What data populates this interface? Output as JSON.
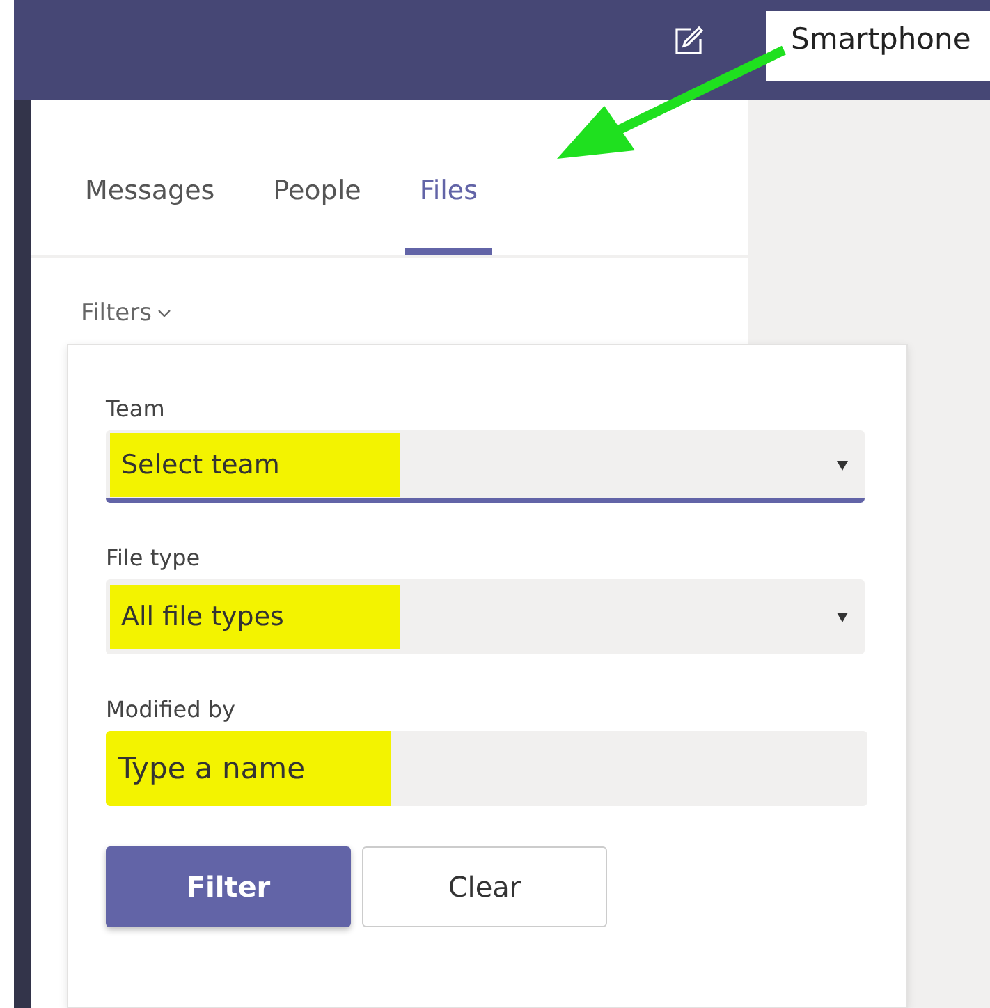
{
  "header": {
    "label": "Smartphone"
  },
  "tabs": [
    {
      "label": "Messages",
      "selected": false
    },
    {
      "label": "People",
      "selected": false
    },
    {
      "label": "Files",
      "selected": true
    }
  ],
  "filters_toggle": {
    "label": "Filters",
    "expanded": true
  },
  "filter_form": {
    "fields": [
      {
        "kind": "dropdown",
        "label": "Team",
        "value": "Select team",
        "focused": true
      },
      {
        "kind": "dropdown",
        "label": "File type",
        "value": "All file types",
        "focused": false
      },
      {
        "kind": "text",
        "label": "Modified by",
        "placeholder": "Type a name",
        "focused": false
      }
    ],
    "buttons": [
      {
        "label": "Filter",
        "kind": "primary"
      },
      {
        "label": "Clear",
        "kind": "secondary"
      }
    ]
  }
}
